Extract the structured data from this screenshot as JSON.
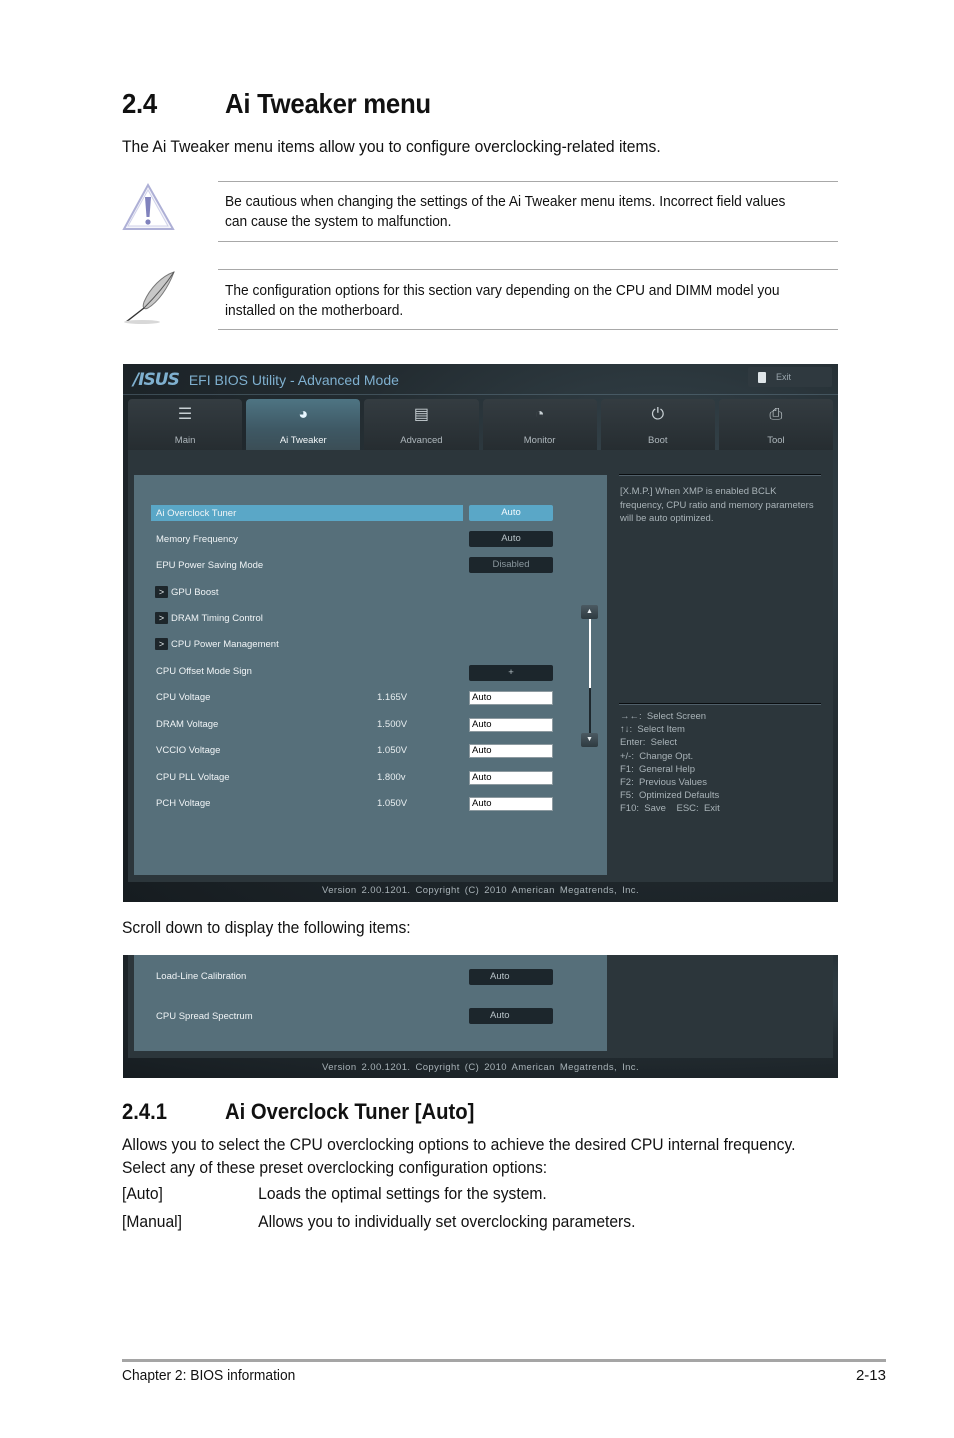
{
  "section": {
    "number": "2.4",
    "title": "Ai Tweaker menu",
    "intro": "The Ai Tweaker menu items allow you to configure overclocking-related items."
  },
  "notes": [
    {
      "icon": "warning-icon",
      "text": "Be cautious when changing the settings of the Ai Tweaker menu items. Incorrect field values can cause the system to malfunction."
    },
    {
      "icon": "note-feather-icon",
      "text": "The configuration options for this section vary depending on the CPU and DIMM model you installed on the motherboard."
    }
  ],
  "bios": {
    "logo": "/ISUS",
    "title": "EFI BIOS Utility - Advanced Mode",
    "exit_label": "Exit",
    "tabs": [
      {
        "label": "Main",
        "icon": "list-icon",
        "glyph": "☰",
        "active": false
      },
      {
        "label": "Ai  Tweaker",
        "icon": "ai-tweaker-icon",
        "glyph": "◕",
        "active": true
      },
      {
        "label": "Advanced",
        "icon": "advanced-icon",
        "glyph": "▤",
        "active": false
      },
      {
        "label": "Monitor",
        "icon": "monitor-icon",
        "glyph": "◔",
        "active": false
      },
      {
        "label": "Boot",
        "icon": "power-icon",
        "glyph": "⏻",
        "active": false
      },
      {
        "label": "Tool",
        "icon": "tool-icon",
        "glyph": "⎙",
        "active": false
      }
    ],
    "items": [
      {
        "label": "Ai Overclock Tuner",
        "value": "Auto",
        "kind": "select",
        "selected": true
      },
      {
        "label": "Memory Frequency",
        "value": "Auto",
        "kind": "select"
      },
      {
        "label": "EPU Power Saving Mode",
        "value": "Disabled",
        "kind": "select-dim"
      },
      {
        "label": "GPU Boost",
        "kind": "submenu",
        "arrow": ">"
      },
      {
        "label": "DRAM Timing Control",
        "kind": "submenu",
        "arrow": ">"
      },
      {
        "label": "CPU Power Management",
        "kind": "submenu",
        "arrow": ">"
      },
      {
        "label": "CPU Offset Mode Sign",
        "value": "+",
        "kind": "select"
      },
      {
        "label": "CPU Voltage",
        "reading": "1.165V",
        "value": "Auto",
        "kind": "input"
      },
      {
        "label": "DRAM Voltage",
        "reading": "1.500V",
        "value": "Auto",
        "kind": "input"
      },
      {
        "label": "VCCIO Voltage",
        "reading": "1.050V",
        "value": "Auto",
        "kind": "input"
      },
      {
        "label": "CPU PLL Voltage",
        "reading": "1.800v",
        "value": "Auto",
        "kind": "input"
      },
      {
        "label": "PCH Voltage",
        "reading": "1.050V",
        "value": "Auto",
        "kind": "input"
      }
    ],
    "scroll": {
      "up": "▲",
      "down": "▼",
      "position_fraction": 0.0,
      "visible_fraction": 0.6
    },
    "help_text": "[X.M.P.] When XMP is enabled BCLK frequency, CPU ratio and memory parameters will be auto optimized.",
    "keys": [
      "→←:  Select Screen",
      "↑↓:  Select Item",
      "Enter:  Select",
      "+/-:  Change Opt.",
      "F1:  General Help",
      "F2:  Previous Values",
      "F5:  Optimized Defaults",
      "F10:  Save    ESC:  Exit"
    ],
    "version": "Version  2.00.1201.  Copyright  (C)  2010  American  Megatrends,  Inc."
  },
  "scroll_caption": "Scroll down to display the following items:",
  "bios_scrolled": {
    "items": [
      {
        "label": "Load-Line Calibration",
        "value": "Auto"
      },
      {
        "label": "CPU Spread Spectrum",
        "value": "Auto"
      }
    ],
    "version": "Version  2.00.1201.  Copyright  (C)  2010  American  Megatrends,  Inc."
  },
  "subsection": {
    "number": "2.4.1",
    "title": "Ai Overclock Tuner [Auto]",
    "description": "Allows you to select the CPU overclocking options to achieve the desired CPU internal frequency. Select any of these preset overclocking configuration options:",
    "options": [
      {
        "key": "[Auto]",
        "desc": "Loads the optimal settings for the system."
      },
      {
        "key": "[Manual]",
        "desc": "Allows you to individually set overclocking parameters."
      }
    ]
  },
  "footer": {
    "chapter": "Chapter 2: BIOS information",
    "page": "2-13"
  }
}
